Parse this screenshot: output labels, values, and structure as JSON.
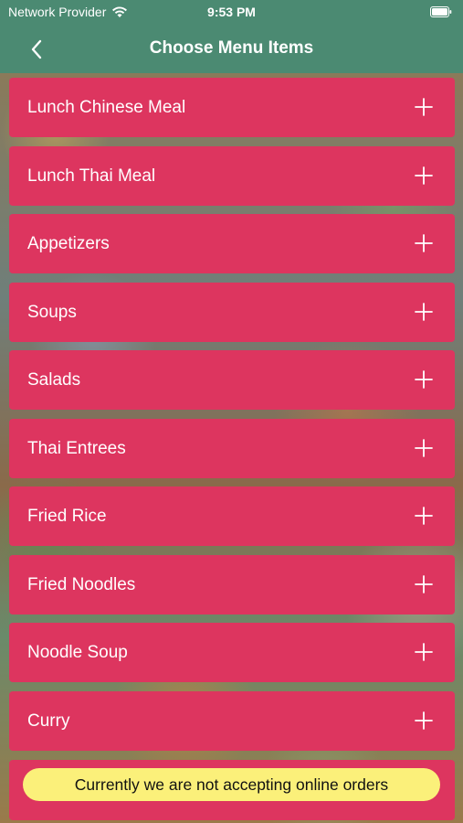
{
  "status_bar": {
    "carrier": "Network Provider",
    "time": "9:53 PM"
  },
  "nav": {
    "title": "Choose Menu Items",
    "back_icon": "chevron-left-icon"
  },
  "menu": {
    "items": [
      {
        "label": "Lunch Chinese Meal"
      },
      {
        "label": "Lunch Thai Meal"
      },
      {
        "label": "Appetizers"
      },
      {
        "label": "Soups"
      },
      {
        "label": "Salads"
      },
      {
        "label": "Thai Entrees"
      },
      {
        "label": "Fried Rice"
      },
      {
        "label": "Fried Noodles"
      },
      {
        "label": "Noodle Soup"
      },
      {
        "label": "Curry"
      }
    ],
    "expand_icon": "plus-icon"
  },
  "notice": {
    "text": "Currently we are not accepting online orders"
  },
  "colors": {
    "header": "#4b8a72",
    "menu_item": "#dd355f",
    "notice_pill": "#fbf07a"
  }
}
